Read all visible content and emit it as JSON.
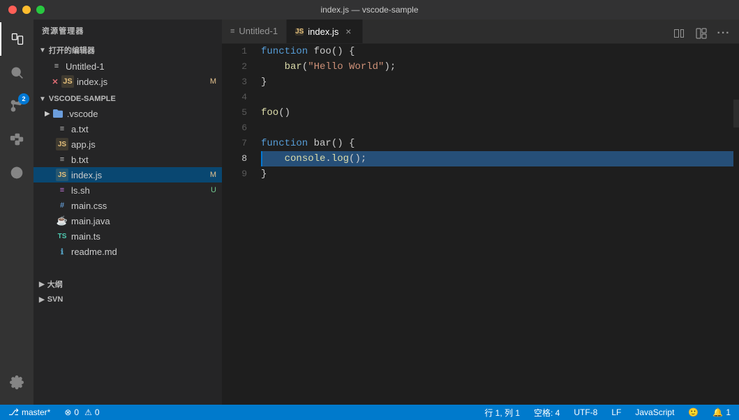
{
  "titleBar": {
    "title": "index.js — vscode-sample"
  },
  "activityBar": {
    "icons": [
      {
        "id": "explorer",
        "label": "Explorer",
        "active": true
      },
      {
        "id": "search",
        "label": "Search",
        "active": false
      },
      {
        "id": "source-control",
        "label": "Source Control",
        "active": false,
        "badge": "2"
      },
      {
        "id": "extensions",
        "label": "Extensions",
        "active": false
      },
      {
        "id": "remote",
        "label": "Remote",
        "active": false
      }
    ],
    "bottomIcons": [
      {
        "id": "settings",
        "label": "Settings"
      }
    ]
  },
  "sidebar": {
    "title": "资源管理器",
    "sections": [
      {
        "id": "open-editors",
        "label": "打开的编辑器",
        "expanded": true,
        "items": [
          {
            "name": "Untitled-1",
            "icon": "txt",
            "indent": 16,
            "badge": ""
          },
          {
            "name": "index.js",
            "icon": "js",
            "indent": 16,
            "badge": "M",
            "selected": true
          }
        ]
      },
      {
        "id": "vscode-sample",
        "label": "VSCODE-SAMPLE",
        "expanded": true,
        "items": [
          {
            "name": ".vscode",
            "icon": "folder-vscode",
            "indent": 16,
            "isFolder": true,
            "badge": ""
          },
          {
            "name": "a.txt",
            "icon": "txt",
            "indent": 16,
            "badge": ""
          },
          {
            "name": "app.js",
            "icon": "js",
            "indent": 16,
            "badge": ""
          },
          {
            "name": "b.txt",
            "icon": "txt",
            "indent": 16,
            "badge": ""
          },
          {
            "name": "index.js",
            "icon": "js",
            "indent": 16,
            "badge": "M",
            "selected": true
          },
          {
            "name": "ls.sh",
            "icon": "sh",
            "indent": 16,
            "badge": "U"
          },
          {
            "name": "main.css",
            "icon": "css",
            "indent": 16,
            "badge": ""
          },
          {
            "name": "main.java",
            "icon": "java",
            "indent": 16,
            "badge": ""
          },
          {
            "name": "main.ts",
            "icon": "ts",
            "indent": 16,
            "badge": ""
          },
          {
            "name": "readme.md",
            "icon": "md",
            "indent": 16,
            "badge": ""
          }
        ]
      }
    ],
    "bottomSections": [
      {
        "id": "outline",
        "label": "大纲"
      },
      {
        "id": "svn",
        "label": "SVN"
      }
    ]
  },
  "tabs": [
    {
      "id": "untitled-1",
      "label": "Untitled-1",
      "icon": "txt",
      "active": false,
      "dirty": false
    },
    {
      "id": "index-js",
      "label": "index.js",
      "icon": "js",
      "active": true,
      "dirty": false
    }
  ],
  "editor": {
    "lines": [
      {
        "num": 1,
        "tokens": [
          {
            "type": "kw",
            "text": "function"
          },
          {
            "type": "plain",
            "text": " foo() {"
          }
        ]
      },
      {
        "num": 2,
        "tokens": [
          {
            "type": "plain",
            "text": "    "
          },
          {
            "type": "method",
            "text": "bar"
          },
          {
            "type": "str",
            "text": "(\"Hello World\")"
          },
          {
            "type": "plain",
            "text": ");"
          }
        ]
      },
      {
        "num": 3,
        "tokens": [
          {
            "type": "plain",
            "text": "}"
          }
        ]
      },
      {
        "num": 4,
        "tokens": []
      },
      {
        "num": 5,
        "tokens": [
          {
            "type": "fn",
            "text": "foo"
          },
          {
            "type": "plain",
            "text": "()"
          }
        ]
      },
      {
        "num": 6,
        "tokens": []
      },
      {
        "num": 7,
        "tokens": [
          {
            "type": "kw",
            "text": "function"
          },
          {
            "type": "plain",
            "text": " bar() {"
          }
        ]
      },
      {
        "num": 8,
        "tokens": [
          {
            "type": "plain",
            "text": "    "
          },
          {
            "type": "method",
            "text": "console"
          },
          {
            "type": "plain",
            "text": "."
          },
          {
            "type": "method",
            "text": "log"
          },
          {
            "type": "plain",
            "text": "();"
          }
        ],
        "highlighted": true,
        "currentLine": true
      },
      {
        "num": 9,
        "tokens": [
          {
            "type": "plain",
            "text": "}"
          }
        ]
      }
    ],
    "activeLine": 8,
    "activeColumn": 1
  },
  "statusBar": {
    "branch": "master*",
    "errors": "0",
    "warnings": "0",
    "position": "行 1, 列 1",
    "spaces": "空格: 4",
    "encoding": "UTF-8",
    "lineEnding": "LF",
    "language": "JavaScript",
    "notifications": "1"
  }
}
